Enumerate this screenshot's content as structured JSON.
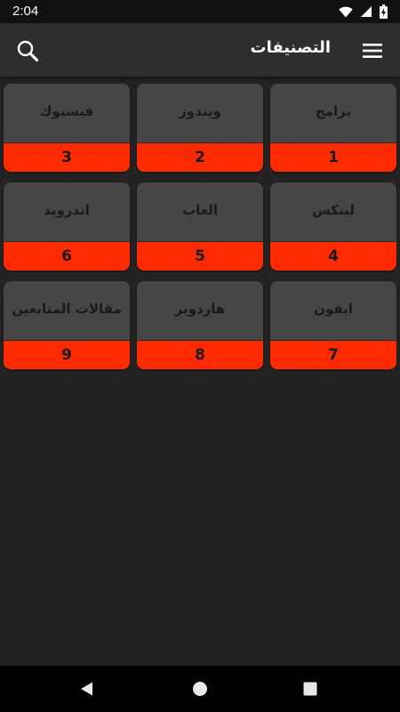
{
  "status_bar": {
    "time": "2:04",
    "icons": [
      "wifi-icon",
      "signal-icon",
      "battery-charging-icon"
    ]
  },
  "app_bar": {
    "title": "التصنيفات",
    "left_icon": "search-icon",
    "right_icon": "menu-icon"
  },
  "colors": {
    "background": "#232323",
    "app_bar": "#2e2e2e",
    "card": "#464646",
    "accent": "#ff2a00"
  },
  "categories": [
    {
      "label": "برامج",
      "number": "1"
    },
    {
      "label": "ويندوز",
      "number": "2"
    },
    {
      "label": "فيسبوك",
      "number": "3"
    },
    {
      "label": "لينكس",
      "number": "4"
    },
    {
      "label": "العاب",
      "number": "5"
    },
    {
      "label": "اندرويد",
      "number": "6"
    },
    {
      "label": "ايفون",
      "number": "7"
    },
    {
      "label": "هاردوير",
      "number": "8"
    },
    {
      "label": "مقالات المتابعين",
      "number": "9"
    }
  ],
  "nav_bar": {
    "buttons": [
      "back-icon",
      "home-icon",
      "recents-icon"
    ]
  }
}
